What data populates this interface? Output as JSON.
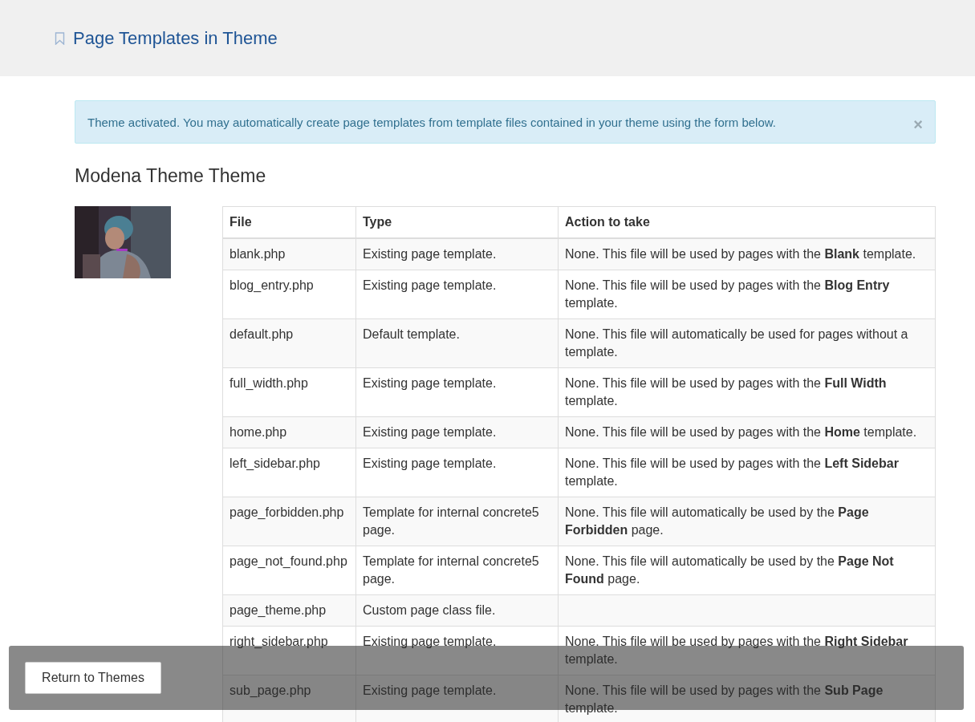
{
  "header": {
    "title": "Page Templates in Theme"
  },
  "alert": {
    "message": "Theme activated. You may automatically create page templates from template files contained in your theme using the form below.",
    "close": "×"
  },
  "theme": {
    "title": "Modena Theme Theme"
  },
  "table": {
    "columns": [
      "File",
      "Type",
      "Action to take"
    ],
    "rows": [
      {
        "file": "blank.php",
        "type": "Existing page template.",
        "action": "None. This file will be used by pages with the **Blank** template."
      },
      {
        "file": "blog_entry.php",
        "type": "Existing page template.",
        "action": "None. This file will be used by pages with the **Blog Entry** template."
      },
      {
        "file": "default.php",
        "type": "Default template.",
        "action": "None. This file will automatically be used for pages without a template."
      },
      {
        "file": "full_width.php",
        "type": "Existing page template.",
        "action": "None. This file will be used by pages with the **Full Width** template."
      },
      {
        "file": "home.php",
        "type": "Existing page template.",
        "action": "None. This file will be used by pages with the **Home** template."
      },
      {
        "file": "left_sidebar.php",
        "type": "Existing page template.",
        "action": "None. This file will be used by pages with the **Left Sidebar** template."
      },
      {
        "file": "page_forbidden.php",
        "type": "Template for internal concrete5 page.",
        "action": "None. This file will automatically be used by the **Page Forbidden** page."
      },
      {
        "file": "page_not_found.php",
        "type": "Template for internal concrete5 page.",
        "action": "None. This file will automatically be used by the **Page Not Found** page."
      },
      {
        "file": "page_theme.php",
        "type": "Custom page class file."
      },
      {
        "file": "right_sidebar.php",
        "type": "Existing page template.",
        "action": "None. This file will be used by pages with the **Right Sidebar** template."
      },
      {
        "file": "sub_page.php",
        "type": "Existing page template.",
        "action": "None. This file will be used by pages with the **Sub Page** template."
      }
    ]
  },
  "footer": {
    "button": "Return to Themes"
  }
}
